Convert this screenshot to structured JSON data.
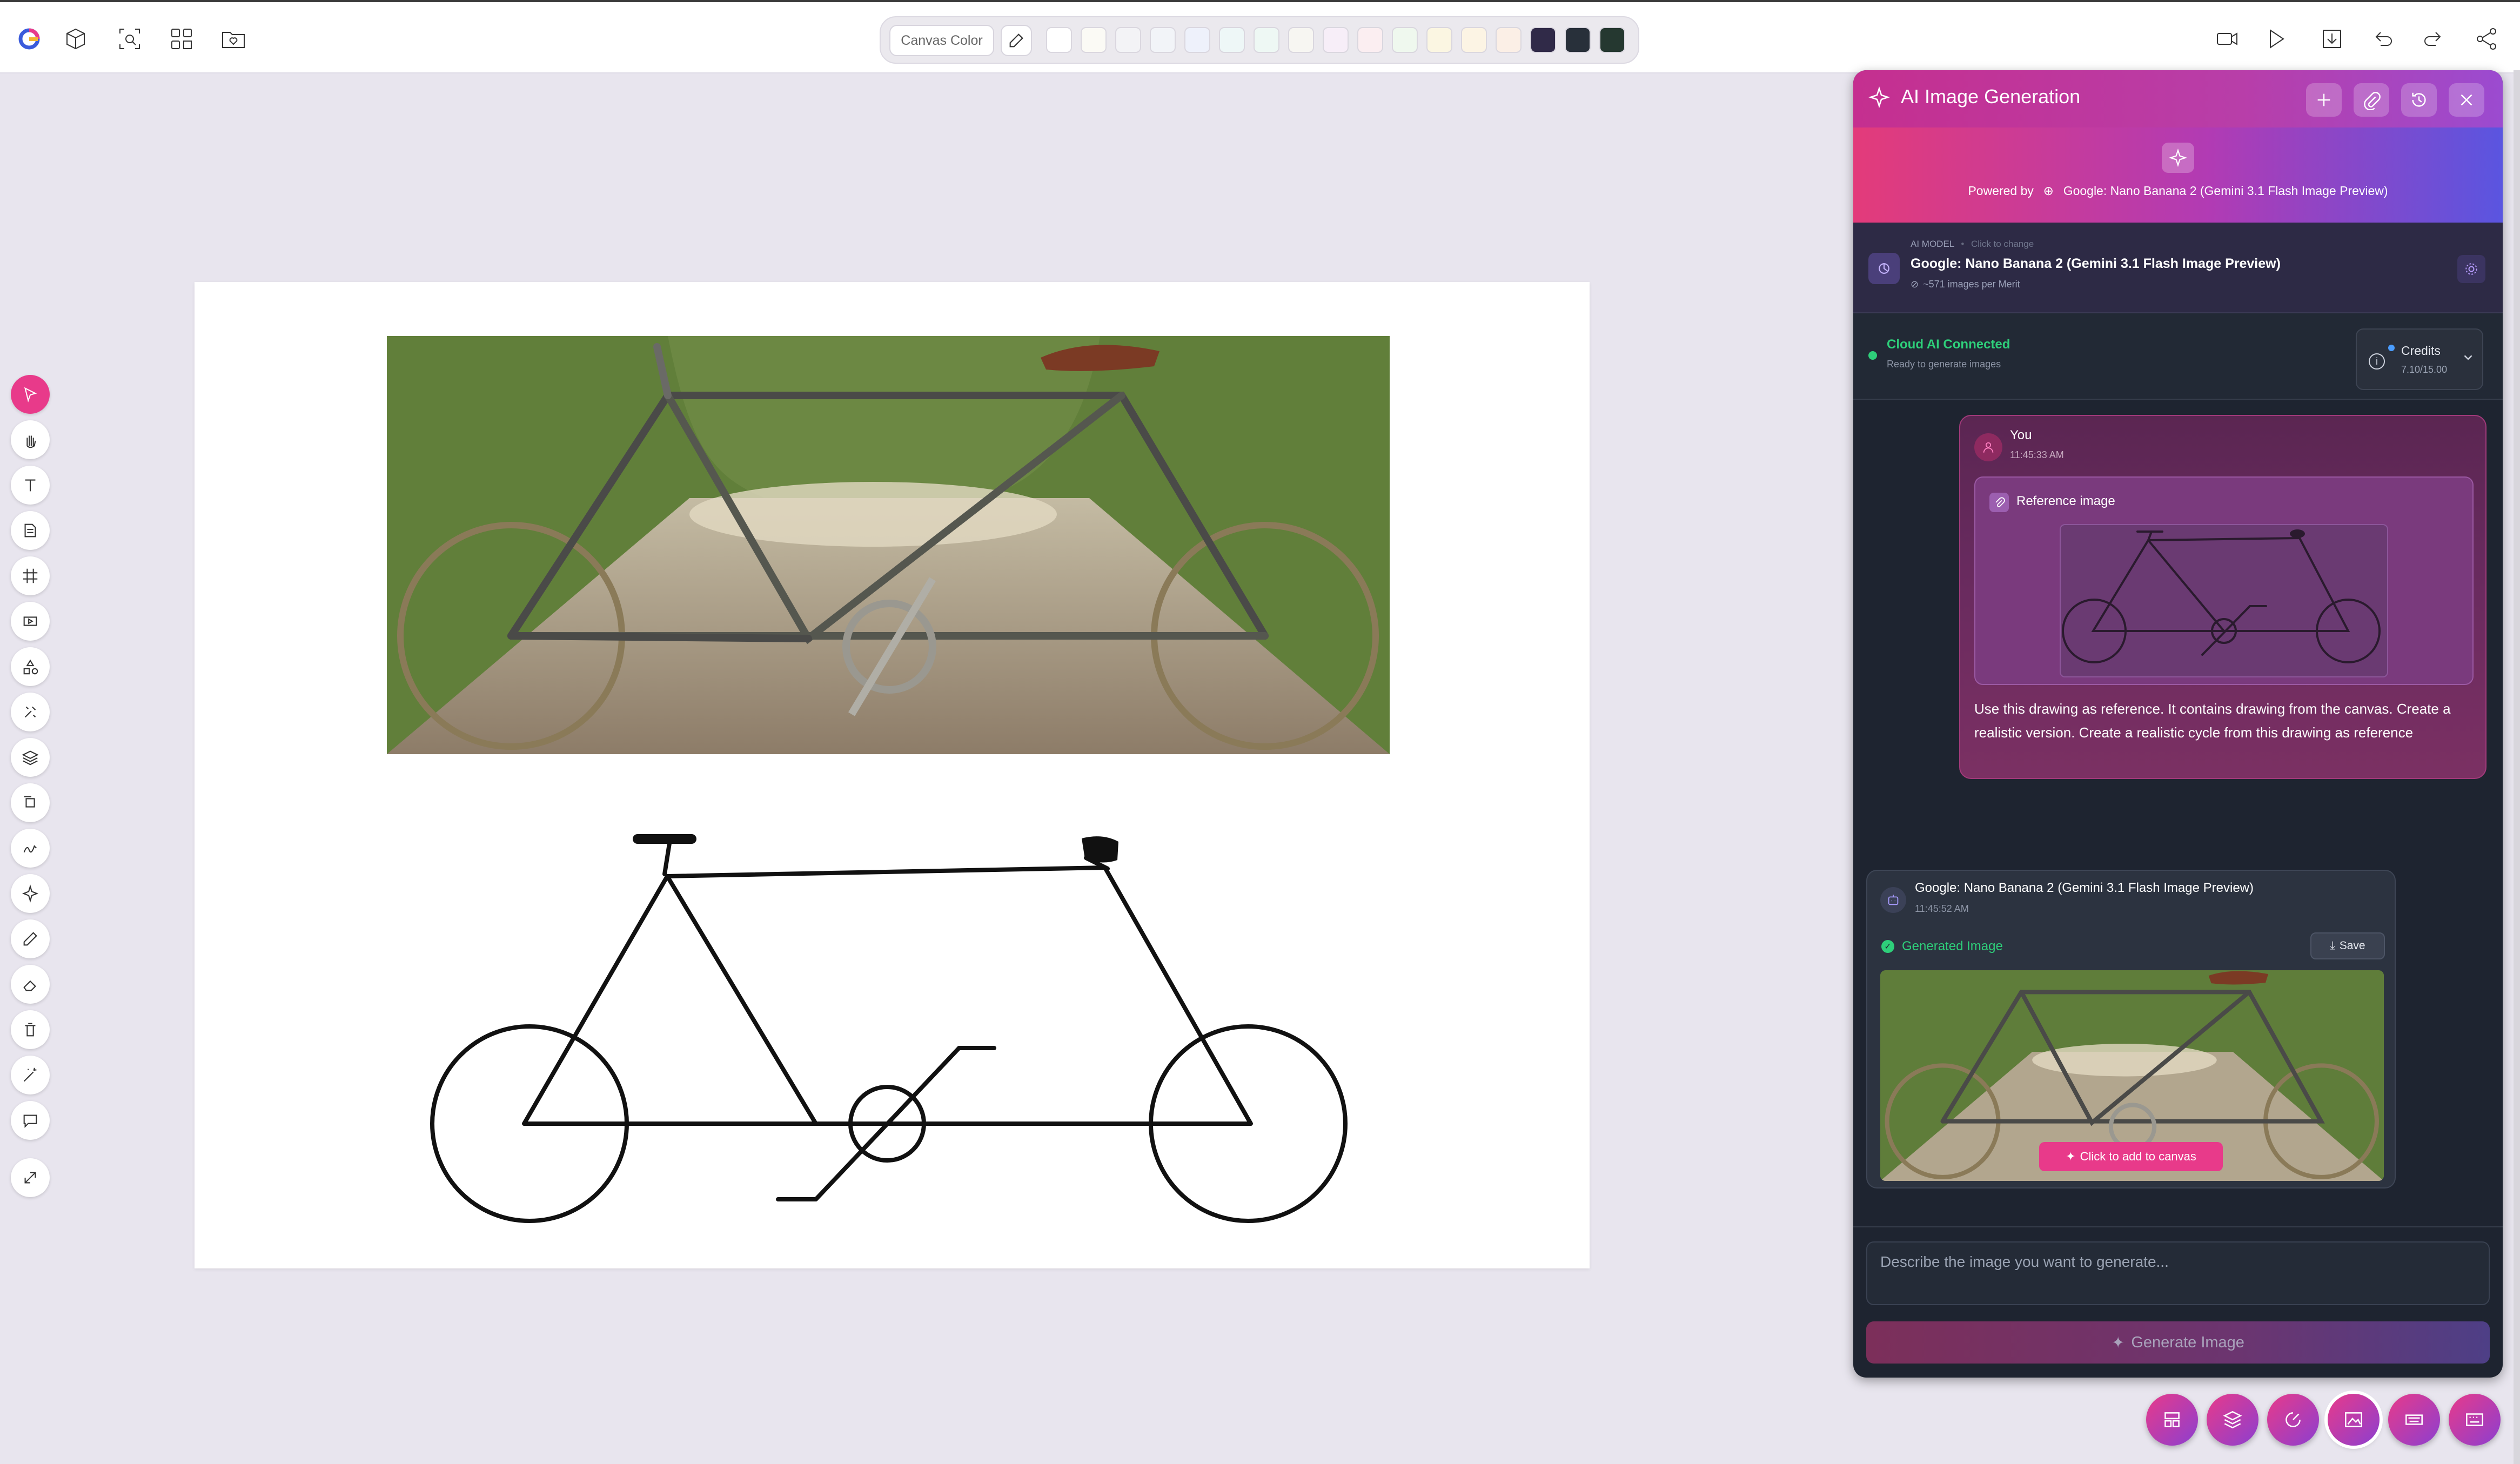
{
  "toolbar": {
    "logo_icon": "app-logo-icon",
    "left_icons": [
      "import-3d-icon",
      "screenshot-icon",
      "qr-code-icon",
      "folder-heart-icon"
    ],
    "canvas_color_label": "Canvas Color",
    "swatches": [
      "#ffffff",
      "#fbfaf5",
      "#f3f3f6",
      "#f2f4f8",
      "#eef1fb",
      "#eef7f7",
      "#eef8f4",
      "#f7f6f2",
      "#f7eef8",
      "#fbeef1",
      "#eff8ee",
      "#fbf6e2",
      "#fcf4e4",
      "#fbefe6",
      "#302a48",
      "#28303a",
      "#253830"
    ],
    "right_icons": [
      "video-icon",
      "play-icon",
      "download-icon",
      "undo-icon",
      "redo-icon",
      "share-icon"
    ]
  },
  "left_tools": [
    "select-tool",
    "hand-tool",
    "text-tool",
    "note-tool",
    "frame-tool",
    "video-tool",
    "shapes-tool",
    "ai-brush-tool",
    "layers-tool",
    "duplicate-tool",
    "signature-tool",
    "sparkle-tool",
    "pencil-tool",
    "eraser-tool",
    "trash-tool",
    "magic-wand-tool",
    "comment-tool",
    "fullscreen-tool"
  ],
  "panel": {
    "title": "AI Image Generation",
    "header_buttons": [
      "new-chat-icon",
      "attach-icon",
      "history-icon",
      "close-icon"
    ],
    "powered_by_label": "Powered by",
    "powered_by_model": "Google: Nano Banana 2 (Gemini 3.1 Flash Image Preview)",
    "model_section_label": "AI MODEL",
    "model_hint": "Click to change",
    "model_name": "Google: Nano Banana 2 (Gemini 3.1 Flash Image Preview)",
    "model_rate": "~571 images per Merit",
    "status_title": "Cloud AI Connected",
    "status_sub": "Ready to generate images",
    "credits_label": "Credits",
    "credits_value": "7.10/15.00",
    "status_color": "#2ecf7a"
  },
  "chat": {
    "user_name": "You",
    "user_time": "11:45:33 AM",
    "reference_label": "Reference image",
    "user_message": "Use this drawing as reference. It contains drawing from the canvas. Create a realistic version. Create a realistic cycle from this drawing as reference",
    "bot_name": "Google: Nano Banana 2 (Gemini 3.1 Flash Image Preview)",
    "bot_time": "11:45:52 AM",
    "generated_label": "Generated Image",
    "save_label": "Save",
    "add_to_canvas_label": "Click to add to canvas"
  },
  "composer": {
    "placeholder": "Describe the image you want to generate...",
    "generate_label": "Generate Image"
  },
  "bottom_fabs": [
    "templates-icon",
    "layers-icon",
    "ai-model-icon",
    "image-icon",
    "keyboard-icon",
    "shortcuts-icon"
  ],
  "accent": "#e83a8a"
}
